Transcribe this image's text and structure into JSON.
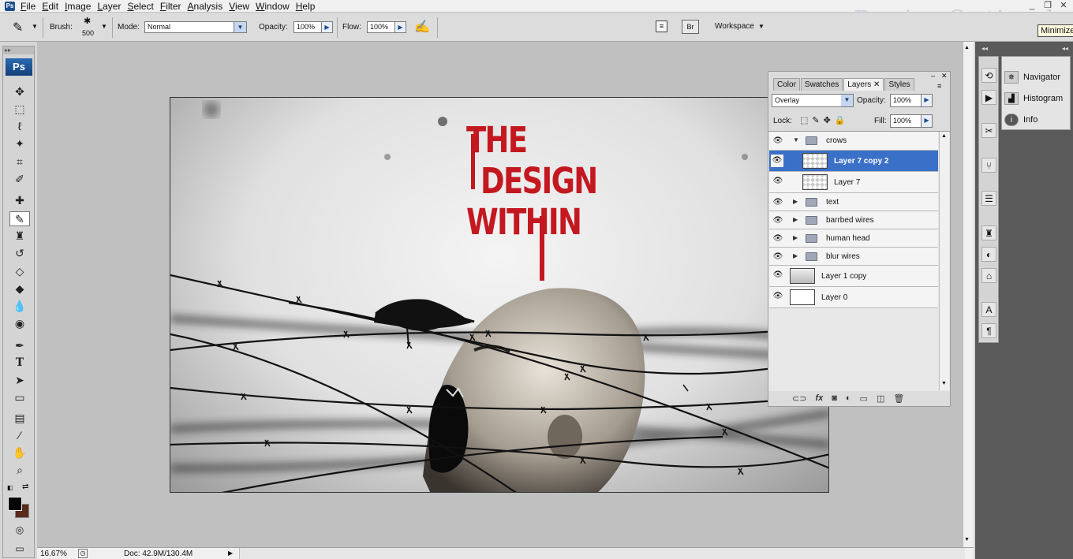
{
  "app": {
    "logo": "Ps"
  },
  "menubar": {
    "items": [
      "File",
      "Edit",
      "Image",
      "Layer",
      "Select",
      "Filter",
      "Analysis",
      "View",
      "Window",
      "Help"
    ]
  },
  "window_controls": {
    "minimize": "_",
    "restore": "❐",
    "close": "✕"
  },
  "watermark": "DesignOptimal.com",
  "tooltip": "Minimize",
  "options": {
    "brush_label": "Brush:",
    "brush_size": "500",
    "mode_label": "Mode:",
    "mode_value": "Normal",
    "opacity_label": "Opacity:",
    "opacity_value": "100%",
    "flow_label": "Flow:",
    "flow_value": "100%",
    "workspace_label": "Workspace"
  },
  "toolbox": {
    "logo": "Ps"
  },
  "artwork": {
    "headline": [
      "THE",
      "DESIGN",
      "WITHIN"
    ]
  },
  "layers_panel": {
    "tabs": [
      "Color",
      "Swatches",
      "Layers",
      "Styles"
    ],
    "active_tab": "Layers",
    "blend_mode": "Overlay",
    "opacity_label": "Opacity:",
    "opacity_value": "100%",
    "lock_label": "Lock:",
    "fill_label": "Fill:",
    "fill_value": "100%",
    "layers": [
      {
        "name": "crows",
        "type": "group",
        "expanded": true
      },
      {
        "name": "Layer 7 copy 2",
        "type": "layer",
        "selected": true
      },
      {
        "name": "Layer 7",
        "type": "layer"
      },
      {
        "name": "text",
        "type": "group"
      },
      {
        "name": "barrbed wires",
        "type": "group"
      },
      {
        "name": "human head",
        "type": "group"
      },
      {
        "name": "blur wires",
        "type": "group"
      },
      {
        "name": "Layer 1 copy",
        "type": "layer"
      },
      {
        "name": "Layer 0",
        "type": "layer"
      }
    ]
  },
  "dock_panel": {
    "items": [
      "Navigator",
      "Histogram",
      "Info"
    ]
  },
  "status": {
    "zoom": "16.67%",
    "doc": "Doc: 42.9M/130.4M"
  }
}
